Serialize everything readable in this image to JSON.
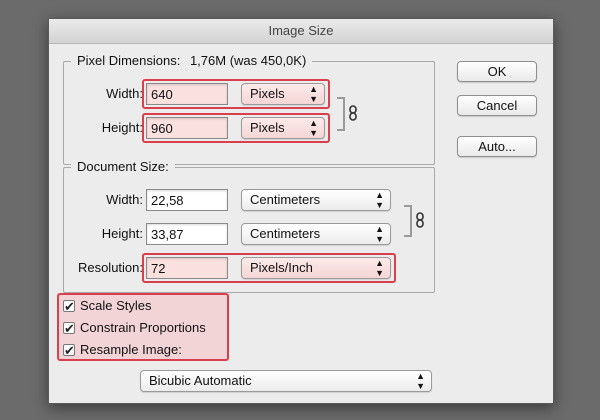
{
  "window": {
    "title": "Image Size"
  },
  "pixel_dimensions": {
    "title": "Pixel Dimensions:",
    "size": "1,76M (was 450,0K)",
    "width": {
      "label": "Width:",
      "value": "640",
      "unit": "Pixels"
    },
    "height": {
      "label": "Height:",
      "value": "960",
      "unit": "Pixels"
    }
  },
  "document_size": {
    "title": "Document Size:",
    "width": {
      "label": "Width:",
      "value": "22,58",
      "unit": "Centimeters"
    },
    "height": {
      "label": "Height:",
      "value": "33,87",
      "unit": "Centimeters"
    },
    "resolution": {
      "label": "Resolution:",
      "value": "72",
      "unit": "Pixels/Inch"
    }
  },
  "options": {
    "scale_styles": {
      "label": "Scale Styles",
      "checked": true
    },
    "constrain": {
      "label": "Constrain Proportions",
      "checked": true
    },
    "resample": {
      "label": "Resample Image:",
      "checked": true
    },
    "method": "Bicubic Automatic"
  },
  "buttons": {
    "ok": "OK",
    "cancel": "Cancel",
    "auto": "Auto..."
  },
  "colors": {
    "highlight": "#d9404b",
    "highlight_fill": "#fbe0e0"
  }
}
